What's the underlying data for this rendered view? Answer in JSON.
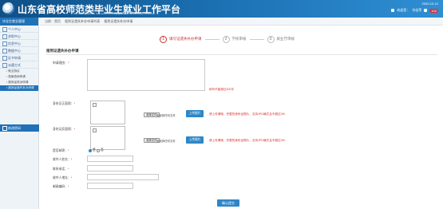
{
  "header": {
    "title": "山东省高校师范类毕业生就业工作平台",
    "subtitle": "Job hunting platform for normal university graduates in Shandong Province",
    "date": "2020-10-12",
    "user_label": "欢迎您：",
    "user_name": "孙金萍",
    "badge": "100"
  },
  "sidebar": {
    "head": "毕业生就业管理",
    "items": [
      "个人中心",
      "求职中心",
      "信息中心",
      "数据中心",
      "证书申请"
    ],
    "active_group": "派遣方式",
    "subs": [
      "就业协议",
      "档案查询申请",
      "报到证改派申请",
      "报到证遗失补办申请"
    ],
    "bottom": "修改密码"
  },
  "breadcrumb": [
    "当前：首页",
    "报到证遗失补办申请列表",
    "报到证遗失补办申请"
  ],
  "steps": [
    {
      "num": "1",
      "label": "填写证遗失补办申请"
    },
    {
      "num": "2",
      "label": "学校审核"
    },
    {
      "num": "3",
      "label": "就业厅审核"
    }
  ],
  "form": {
    "section_title": "报到证遗失补办申请",
    "reason_label": "申请理由：",
    "reason_hint": "填写不能超过200字",
    "front_label": "身份证正面照：",
    "back_label": "身份证反面照：",
    "file_button": "选择文件",
    "file_status": "未选择任何文件",
    "upload_button": "上传图片",
    "upload_hint": "请上传清晰、完整的身份证照片，支持JPG格式且不超过2M",
    "send_label": "是否邮寄：",
    "radio_yes": "是",
    "radio_no": "否",
    "receiver_label": "收件人姓名：",
    "phone_label": "联系电话：",
    "address_label": "收件人地址：",
    "postcode_label": "邮政编码：",
    "submit_button": "确认提交"
  }
}
